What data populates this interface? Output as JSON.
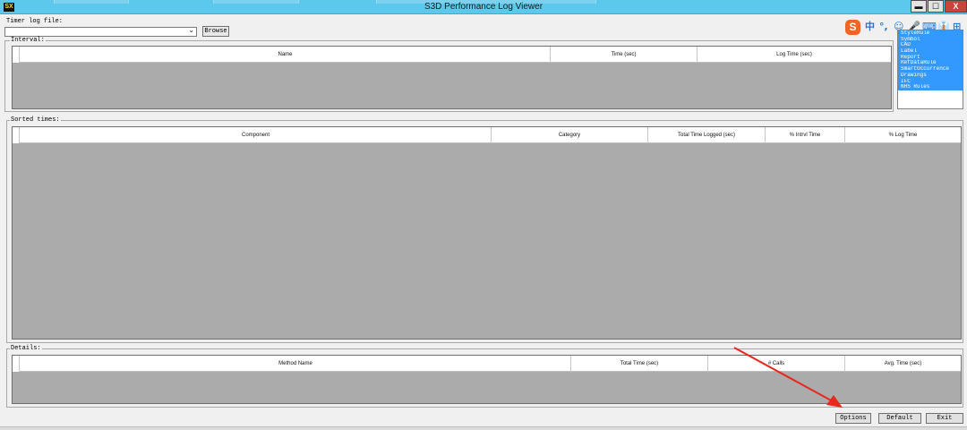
{
  "window": {
    "title": "S3D Performance Log Viewer",
    "app_icon_text": "SX",
    "minimize_glyph": "▬",
    "maximize_glyph": "☐",
    "close_glyph": "X"
  },
  "ime_toolbar": {
    "logo": "S",
    "items": [
      "中",
      "°,",
      "☺",
      "🎤",
      "⌨",
      "👔",
      "⊞"
    ],
    "icon_names": [
      "sogou-logo-icon",
      "chinese-mode-icon",
      "punctuation-icon",
      "emoji-icon",
      "microphone-icon",
      "keyboard-icon",
      "skin-icon",
      "toolbox-icon"
    ]
  },
  "timer_log": {
    "label": "Timer log file:",
    "value": "",
    "browse_label": "Browse"
  },
  "interval": {
    "label": "Interval:",
    "columns": [
      "Name",
      "Time (sec)",
      "Log Time (sec)"
    ]
  },
  "filters": {
    "items": [
      "StyleRule",
      "Symbol",
      "CAD",
      "Label",
      "Report",
      "RefDataRule",
      "SmartOccurrence",
      "Drawings",
      "IFC",
      "NHS Rules"
    ]
  },
  "sorted_times": {
    "label": "Sorted times:",
    "columns": [
      "Component",
      "Category",
      "Total Time Logged (sec)",
      "% Intrvl Time",
      "% Log Time"
    ]
  },
  "details": {
    "label": "Details:",
    "columns": [
      "Method Name",
      "Total Time (sec)",
      "# Calls",
      "Avg. Time (sec)"
    ]
  },
  "buttons": {
    "options": "Options",
    "default": "Default",
    "exit": "Exit"
  },
  "colors": {
    "titlebar": "#5bc8ec",
    "grid_background": "#ababab",
    "selection": "#3399ff",
    "close_button": "#c7463c",
    "annotation_arrow": "#e8281e"
  }
}
